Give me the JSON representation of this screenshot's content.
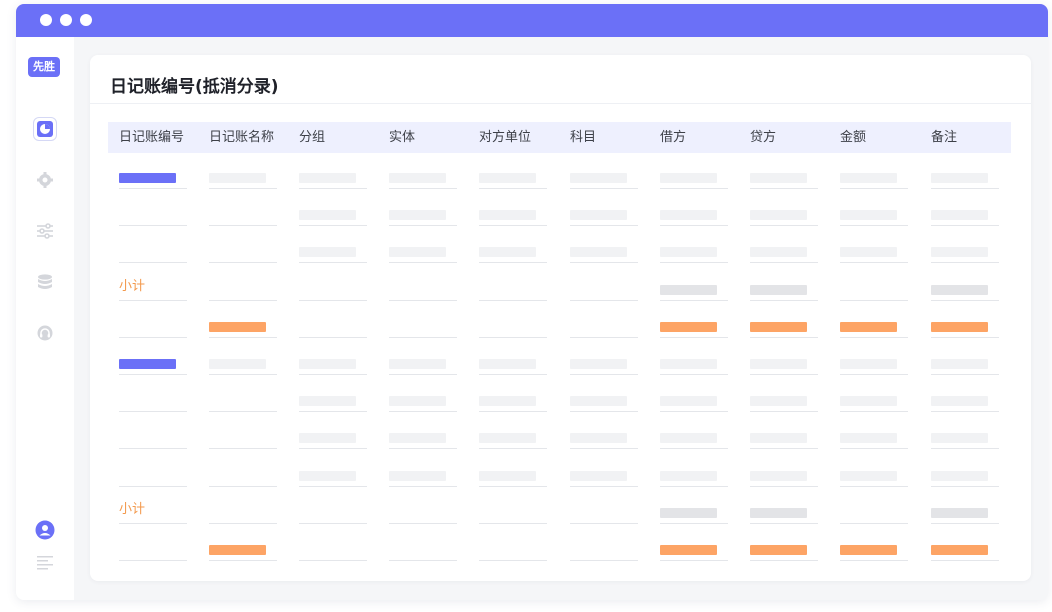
{
  "window": {
    "controls": [
      "dot",
      "dot",
      "dot"
    ]
  },
  "sidebar": {
    "brand": "先胜",
    "nav": [
      {
        "icon": "pie-chart-icon",
        "active": true
      },
      {
        "icon": "gear-icon",
        "active": false
      },
      {
        "icon": "sliders-icon",
        "active": false
      },
      {
        "icon": "database-icon",
        "active": false
      },
      {
        "icon": "headset-icon",
        "active": false
      }
    ],
    "footer": [
      {
        "icon": "user-avatar-icon"
      },
      {
        "icon": "menu-lines-icon"
      }
    ]
  },
  "panel": {
    "title": "日记账编号(抵消分录)",
    "columns": [
      "日记账编号",
      "日记账名称",
      "分组",
      "实体",
      "对方单位",
      "科目",
      "借方",
      "贷方",
      "金额",
      "备注"
    ],
    "subtotal_label": "小计",
    "rows": [
      {
        "kind": "group-first",
        "cells": [
          "blue",
          "light",
          "light",
          "light",
          "light",
          "light",
          "light",
          "light",
          "light",
          "light"
        ]
      },
      {
        "kind": "detail",
        "cells": [
          "",
          "",
          "light",
          "light",
          "light",
          "light",
          "light",
          "light",
          "light",
          "light"
        ]
      },
      {
        "kind": "detail",
        "cells": [
          "",
          "",
          "light",
          "light",
          "light",
          "light",
          "light",
          "light",
          "light",
          "light"
        ]
      },
      {
        "kind": "subtotal",
        "cells": [
          "label",
          "",
          "",
          "",
          "",
          "",
          "mid",
          "mid",
          "",
          "mid"
        ]
      },
      {
        "kind": "total",
        "cells": [
          "",
          "orange",
          "",
          "",
          "",
          "",
          "orange",
          "orange",
          "orange",
          "orange"
        ]
      },
      {
        "kind": "group-first",
        "cells": [
          "blue",
          "light",
          "light",
          "light",
          "light",
          "light",
          "light",
          "light",
          "light",
          "light"
        ]
      },
      {
        "kind": "detail",
        "cells": [
          "",
          "",
          "light",
          "light",
          "light",
          "light",
          "light",
          "light",
          "light",
          "light"
        ]
      },
      {
        "kind": "detail",
        "cells": [
          "",
          "",
          "light",
          "light",
          "light",
          "light",
          "light",
          "light",
          "light",
          "light"
        ]
      },
      {
        "kind": "detail",
        "cells": [
          "",
          "",
          "light",
          "light",
          "light",
          "light",
          "light",
          "light",
          "light",
          "light"
        ]
      },
      {
        "kind": "subtotal",
        "cells": [
          "label",
          "",
          "",
          "",
          "",
          "",
          "mid",
          "mid",
          "",
          "mid"
        ]
      },
      {
        "kind": "total",
        "cells": [
          "",
          "orange",
          "",
          "",
          "",
          "",
          "orange",
          "orange",
          "orange",
          "orange"
        ]
      }
    ]
  }
}
